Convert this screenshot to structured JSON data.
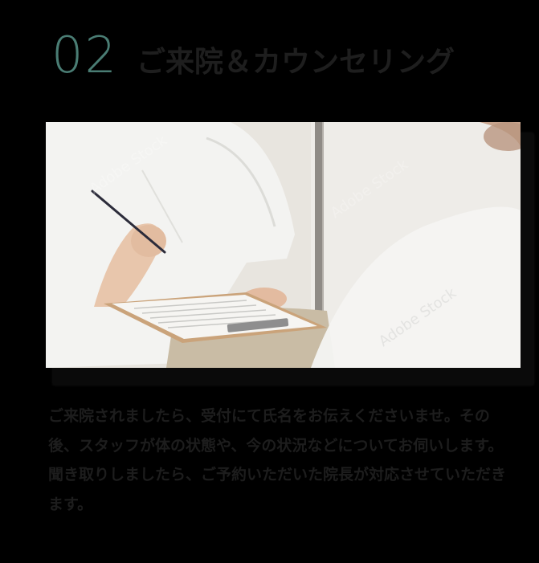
{
  "step": {
    "number": "02",
    "title": "ご来院＆カウンセリング"
  },
  "photo": {
    "description_icon": "counseling-photo",
    "watermark": "Adobe Stock"
  },
  "body": {
    "paragraph_1": "ご来院されましたら、受付にて氏名をお伝えくださいませ。その後、スタッフが体の状態や、今の状況などについてお伺いします。",
    "paragraph_2": "聞き取りしましたら、ご予約いただいた院長が対応させていただきます。"
  },
  "colors": {
    "background": "#000000",
    "accent": "#4a7d74",
    "title": "#1e1e1e",
    "text": "#1d1d1d"
  }
}
